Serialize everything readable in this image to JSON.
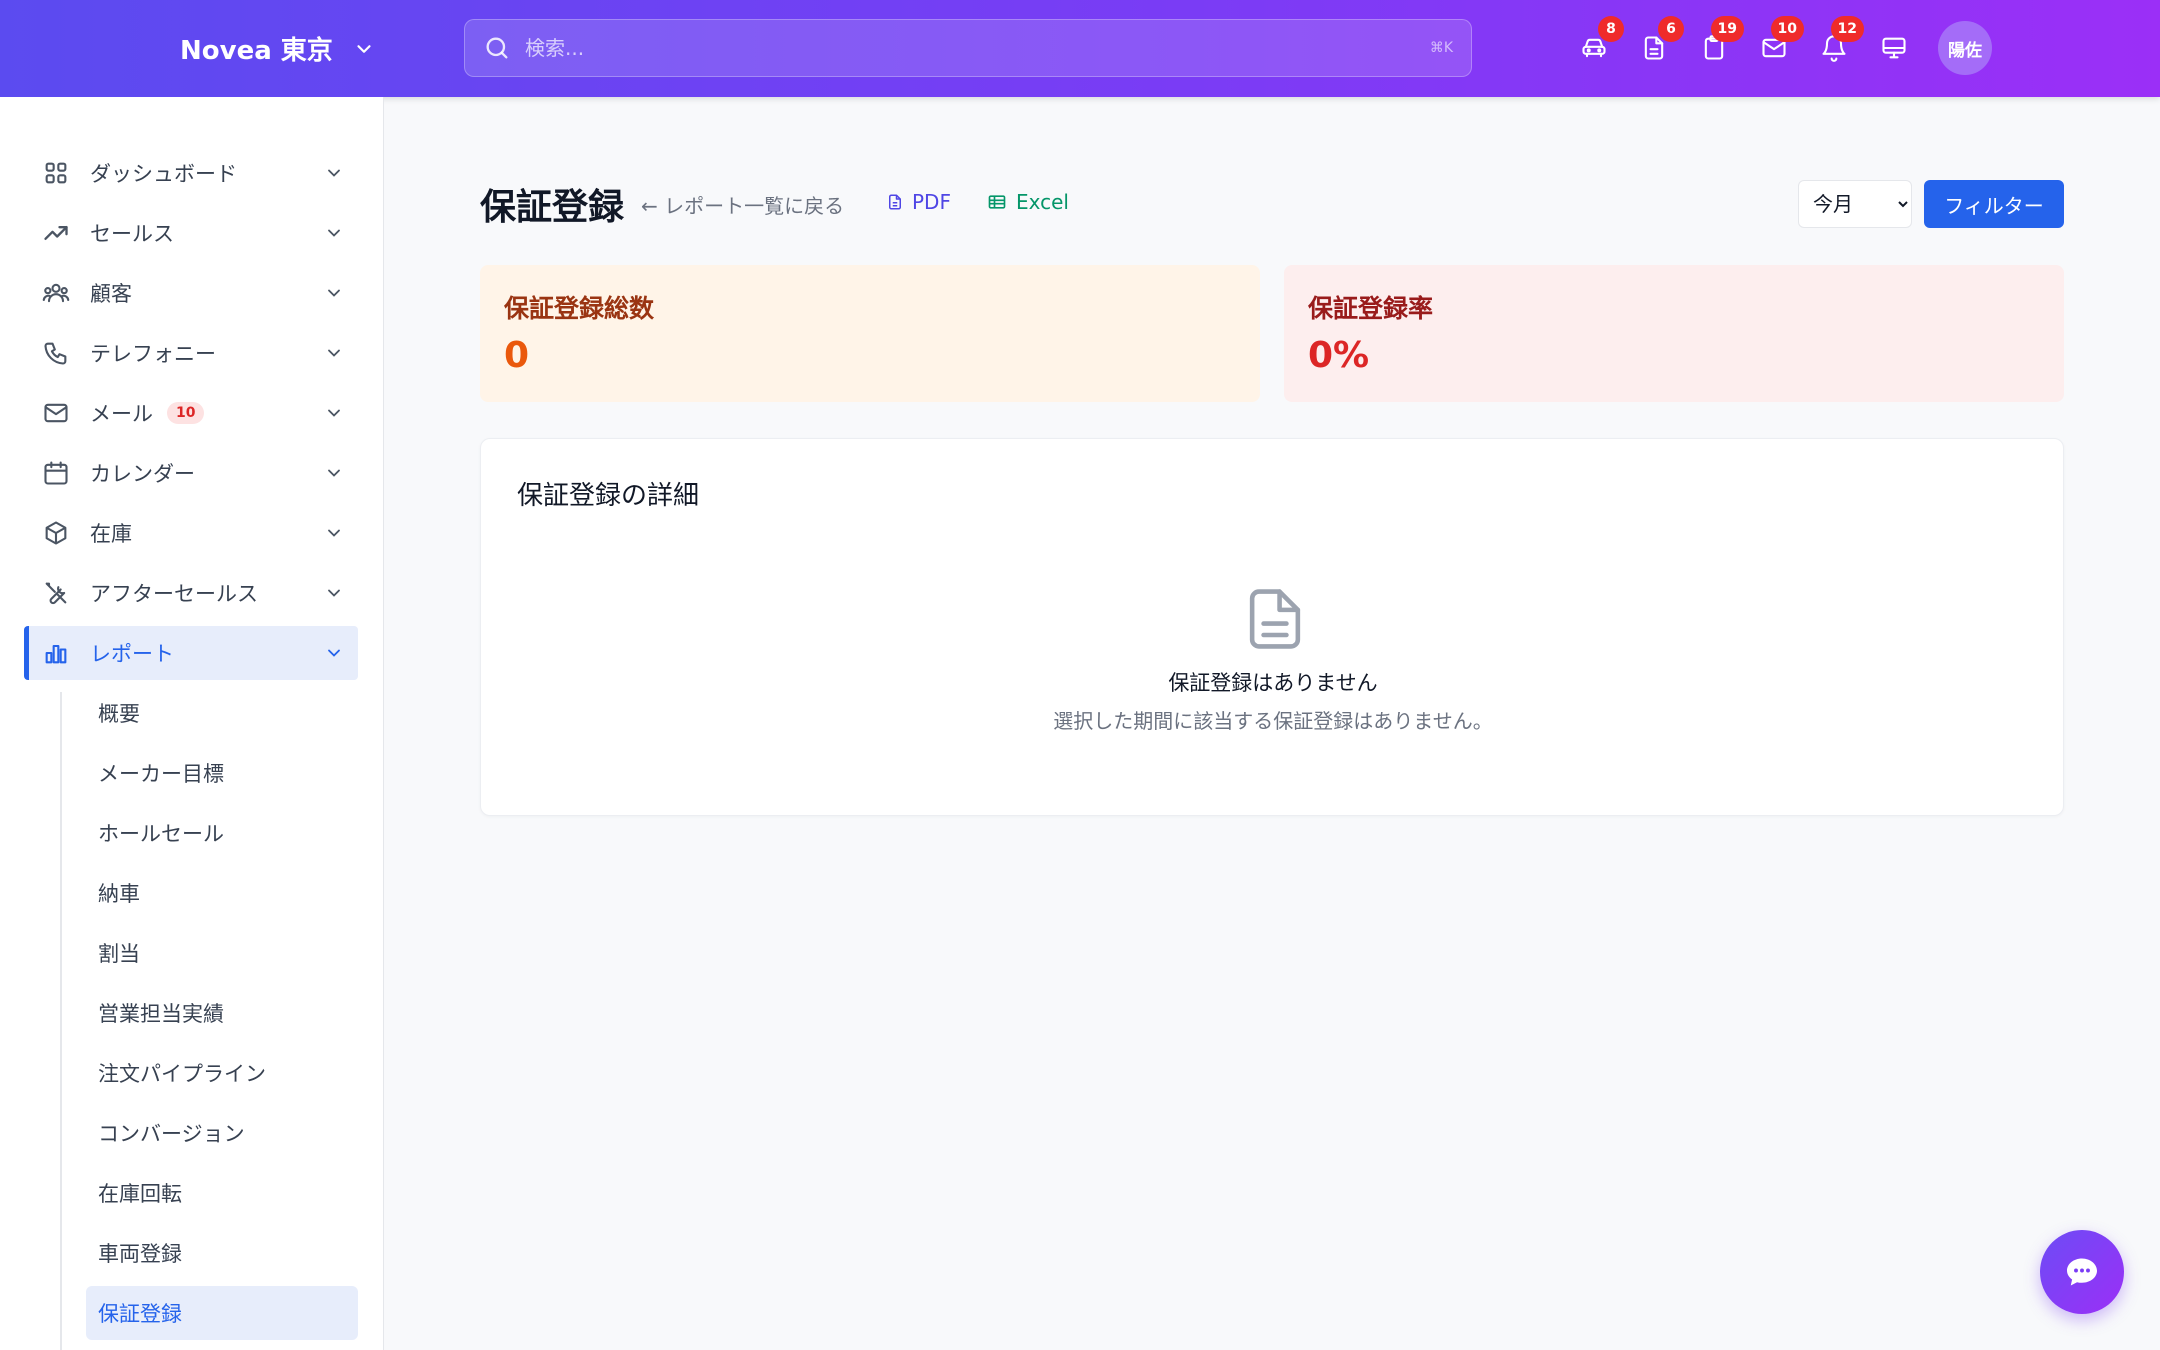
{
  "header": {
    "brand": "Novea 東京",
    "search_placeholder": "検索...",
    "search_shortcut": "⌘K",
    "icons": [
      {
        "name": "car-icon",
        "badge": "8"
      },
      {
        "name": "document-icon",
        "badge": "6"
      },
      {
        "name": "clipboard-icon",
        "badge": "19"
      },
      {
        "name": "mail-icon",
        "badge": "10"
      },
      {
        "name": "bell-icon",
        "badge": "12"
      },
      {
        "name": "monitor-icon",
        "badge": ""
      }
    ],
    "avatar": "陽佐"
  },
  "sidebar": {
    "items": [
      {
        "label": "ダッシュボード",
        "icon": "grid-icon"
      },
      {
        "label": "セールス",
        "icon": "trending-up-icon"
      },
      {
        "label": "顧客",
        "icon": "users-icon"
      },
      {
        "label": "テレフォニー",
        "icon": "phone-icon"
      },
      {
        "label": "メール",
        "icon": "mail-icon",
        "badge": "10"
      },
      {
        "label": "カレンダー",
        "icon": "calendar-icon"
      },
      {
        "label": "在庫",
        "icon": "box-icon"
      },
      {
        "label": "アフターセールス",
        "icon": "tools-icon"
      },
      {
        "label": "レポート",
        "icon": "bar-chart-icon",
        "active": true
      }
    ],
    "report_subitems": [
      {
        "label": "概要"
      },
      {
        "label": "メーカー目標"
      },
      {
        "label": "ホールセール"
      },
      {
        "label": "納車"
      },
      {
        "label": "割当"
      },
      {
        "label": "営業担当実績"
      },
      {
        "label": "注文パイプライン"
      },
      {
        "label": "コンバージョン"
      },
      {
        "label": "在庫回転"
      },
      {
        "label": "車両登録"
      },
      {
        "label": "保証登録",
        "active": true
      }
    ]
  },
  "main": {
    "title": "保証登録",
    "back_link": "← レポート一覧に戻る",
    "pdf_label": "PDF",
    "excel_label": "Excel",
    "period_selected": "今月",
    "filter_button": "フィルター",
    "stats": [
      {
        "label": "保証登録総数",
        "value": "0"
      },
      {
        "label": "保証登録率",
        "value": "0%"
      }
    ],
    "detail": {
      "title": "保証登録の詳細",
      "empty_title": "保証登録はありません",
      "empty_message": "選択した期間に該当する保証登録はありません。"
    }
  },
  "colors": {
    "header_gradient_start": "#5b4bf0",
    "header_gradient_end": "#9b2ff7",
    "accent": "#2563eb",
    "badge": "#ef2b2b"
  }
}
